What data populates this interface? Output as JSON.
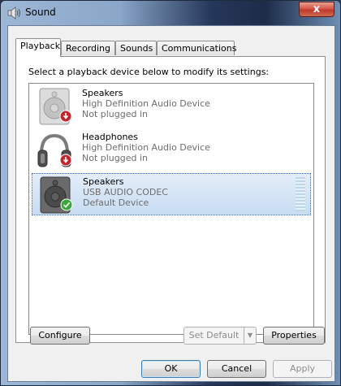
{
  "window": {
    "title": "Sound",
    "close_label": "x"
  },
  "tabs": [
    {
      "label": "Playback",
      "active": true
    },
    {
      "label": "Recording",
      "active": false
    },
    {
      "label": "Sounds",
      "active": false
    },
    {
      "label": "Communications",
      "active": false
    }
  ],
  "instruction": "Select a playback device below to modify its settings:",
  "devices": [
    {
      "name": "Speakers",
      "description": "High Definition Audio Device",
      "status": "Not plugged in",
      "icon": "speaker-icon",
      "status_icon": "unplugged-icon"
    },
    {
      "name": "Headphones",
      "description": "High Definition Audio Device",
      "status": "Not plugged in",
      "icon": "headphones-icon",
      "status_icon": "unplugged-icon"
    },
    {
      "name": "Speakers",
      "description": "USB AUDIO  CODEC",
      "status": "Default Device",
      "icon": "speaker-icon",
      "status_icon": "default-check-icon",
      "selected": true
    }
  ],
  "buttons": {
    "configure": "Configure",
    "set_default": "Set Default",
    "properties": "Properties",
    "ok": "OK",
    "cancel": "Cancel",
    "apply": "Apply"
  },
  "colors": {
    "selection": "#c8dcf2",
    "status_red": "#c4262e",
    "status_green": "#3aa53a"
  }
}
